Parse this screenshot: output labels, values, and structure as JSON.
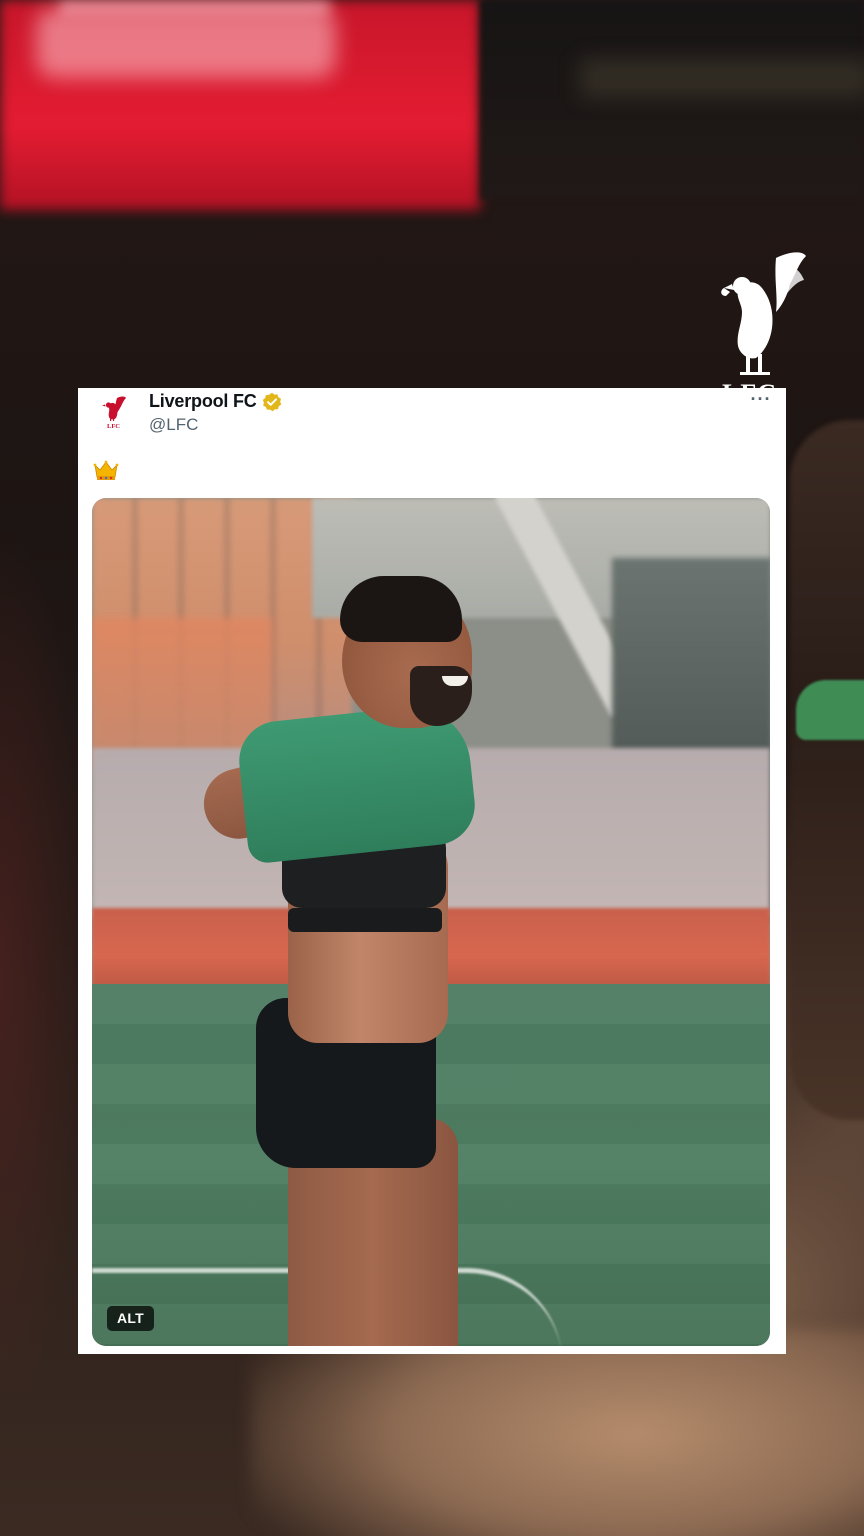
{
  "tweet": {
    "display_name": "Liverpool FC",
    "handle": "@LFC",
    "verified": true,
    "verified_badge_color": "#e2b719",
    "text_emoji_icon": "crown-icon",
    "more_label": "···",
    "media": {
      "alt_badge": "ALT"
    }
  },
  "watermark": {
    "logo_icon": "lfc-liverbird-crest-icon",
    "logo_color": "#ffffff"
  },
  "colors": {
    "card_background": "#ffffff",
    "name_color": "#0f1419",
    "handle_color": "#536471",
    "lfc_red": "#c8102e"
  }
}
